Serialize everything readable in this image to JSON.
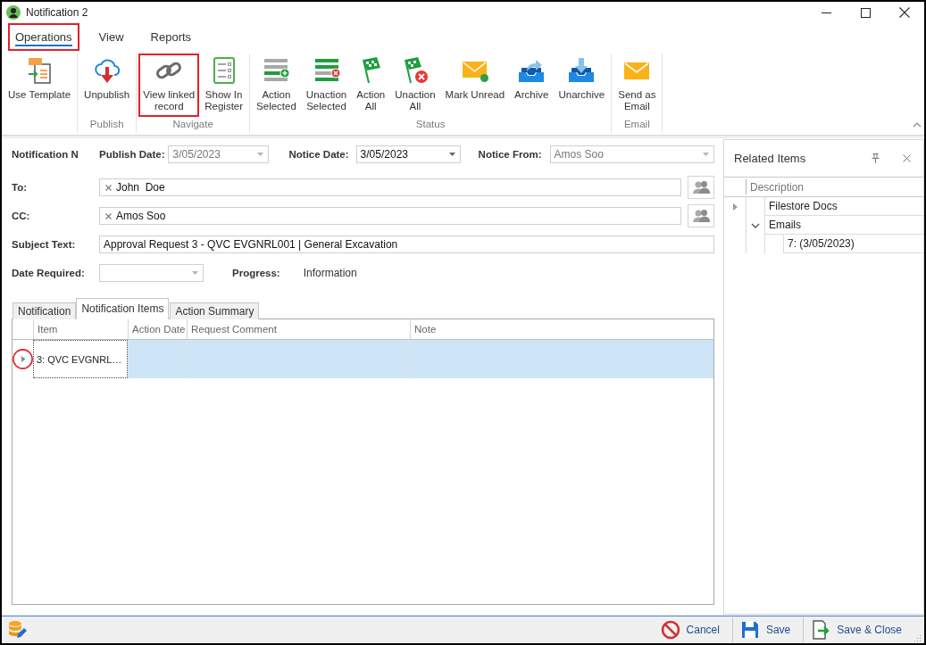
{
  "window": {
    "title": "Notification 2"
  },
  "ribbon": {
    "tabs": [
      {
        "label": "Operations",
        "selected": true,
        "highlighted": true
      },
      {
        "label": "View",
        "selected": false,
        "highlighted": false
      },
      {
        "label": "Reports",
        "selected": false,
        "highlighted": false
      }
    ],
    "groups": [
      {
        "buttons": [
          {
            "kind": "template",
            "label": "Use Template",
            "highlighted": false
          }
        ]
      },
      {
        "label": "Publish",
        "buttons": [
          {
            "kind": "unpublish",
            "label": "Unpublish",
            "highlighted": false
          }
        ]
      },
      {
        "label": "Navigate",
        "buttons": [
          {
            "kind": "link",
            "label": "View linked\nrecord",
            "highlighted": true
          },
          {
            "kind": "register",
            "label": "Show In\nRegister",
            "highlighted": false
          }
        ]
      },
      {
        "label": "Status",
        "buttons": [
          {
            "kind": "addrow",
            "label": "Action\nSelected",
            "highlighted": false
          },
          {
            "kind": "removerow",
            "label": "Unaction\nSelected",
            "highlighted": false
          },
          {
            "kind": "flag",
            "label": "Action\nAll",
            "highlighted": false
          },
          {
            "kind": "unflag",
            "label": "Unaction\nAll",
            "highlighted": false
          },
          {
            "kind": "unread",
            "label": "Mark Unread",
            "highlighted": false
          },
          {
            "kind": "archive",
            "label": "Archive",
            "highlighted": false
          },
          {
            "kind": "unarchive",
            "label": "Unarchive",
            "highlighted": false
          }
        ]
      },
      {
        "label": "Email",
        "buttons": [
          {
            "kind": "email",
            "label": "Send as\nEmail",
            "highlighted": false
          }
        ]
      }
    ]
  },
  "form": {
    "notification_no": {
      "label": "Notification N"
    },
    "publish_date": {
      "label": "Publish Date:",
      "value": "3/05/2023",
      "disabled": true
    },
    "notice_date": {
      "label": "Notice Date:",
      "value": "3/05/2023",
      "disabled": false
    },
    "notice_from": {
      "label": "Notice From:",
      "value": "Amos Soo",
      "disabled": true
    },
    "to": {
      "label": "To:",
      "recipients": [
        "John  Doe"
      ]
    },
    "cc": {
      "label": "CC:",
      "recipients": [
        "Amos Soo"
      ]
    },
    "subject": {
      "label": "Subject Text:",
      "value": "Approval Request 3 - QVC EVGNRL001 | General Excavation"
    },
    "date_required": {
      "label": "Date Required:"
    },
    "progress": {
      "label": "Progress:",
      "value": "Information"
    }
  },
  "detail_tabs": [
    {
      "label": "Notification",
      "selected": false
    },
    {
      "label": "Notification Items",
      "selected": true
    },
    {
      "label": "Action Summary",
      "selected": false
    }
  ],
  "items_table": {
    "columns": [
      "Item",
      "Action Date",
      "Request Comment",
      "Note"
    ],
    "rows": [
      {
        "item": "3: QVC EVGNRL…",
        "selected": true,
        "highlighted": true
      }
    ]
  },
  "related_items": {
    "title": "Related Items",
    "columns": [
      "Description"
    ],
    "tree": [
      {
        "label": "Filestore Docs",
        "focused": true
      },
      {
        "label": "Emails",
        "focused": false,
        "expanded": true,
        "children": [
          {
            "label": "7: (3/05/2023)",
            "focused": false
          }
        ]
      }
    ]
  },
  "status_bar": {
    "buttons": [
      {
        "kind": "cancel",
        "label": "Cancel"
      },
      {
        "kind": "save",
        "label": "Save"
      },
      {
        "kind": "saveclose",
        "label": "Save & Close"
      }
    ]
  }
}
